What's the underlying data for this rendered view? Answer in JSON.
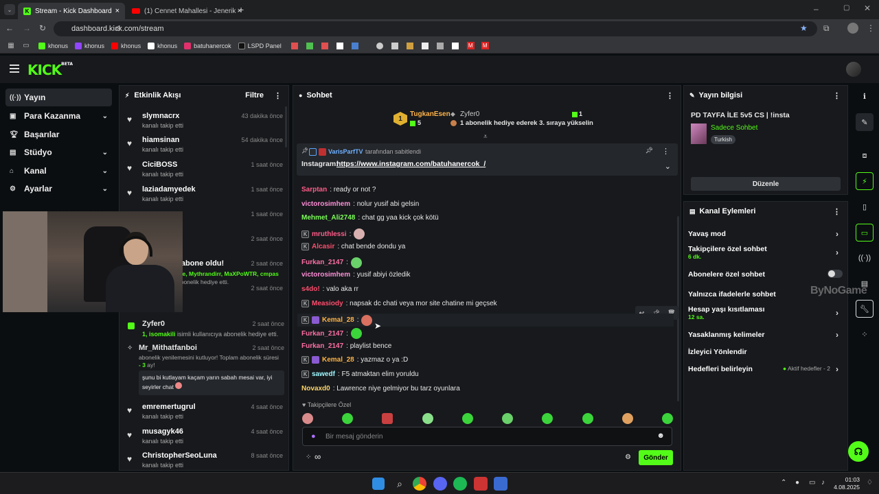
{
  "browser": {
    "tabs": [
      {
        "title": "Stream - Kick Dashboard"
      },
      {
        "title": "(1) Cennet Mahallesi - Jenerik -"
      }
    ],
    "new_tab": "+",
    "url": "dashboard.kick.com/stream",
    "bookmarks": [
      {
        "label": "khonus",
        "color": "#53fc18"
      },
      {
        "label": "khonus",
        "color": "#9146ff"
      },
      {
        "label": "khonus",
        "color": "#ff0000"
      },
      {
        "label": "khonus",
        "color": "#ffffff"
      },
      {
        "label": "batuhanercok",
        "color": "#e1306c"
      },
      {
        "label": "LSPD Panel",
        "color": "#333333"
      }
    ]
  },
  "app": {
    "logo": "KICK",
    "logo_tag": "BETA",
    "accent": "#53fc18"
  },
  "sidebar": {
    "items": [
      {
        "label": "Yayın",
        "icon": "broadcast-icon",
        "chevron": false
      },
      {
        "label": "Para Kazanma",
        "icon": "money-icon",
        "chevron": true
      },
      {
        "label": "Başarılar",
        "icon": "trophy-icon",
        "chevron": false
      },
      {
        "label": "Stüdyo",
        "icon": "studio-icon",
        "chevron": true
      },
      {
        "label": "Kanal",
        "icon": "channel-icon",
        "chevron": true
      },
      {
        "label": "Ayarlar",
        "icon": "gear-icon",
        "chevron": true
      }
    ]
  },
  "activity": {
    "title": "Etkinlik Akışı",
    "filter": "Filtre",
    "events": [
      {
        "name": "slymnacrx",
        "sub": "kanalı takip etti",
        "time": "43 dakika önce"
      },
      {
        "name": "hiamsinan",
        "sub": "kanalı takip etti",
        "time": "54 dakika önce"
      },
      {
        "name": "CiciBOSS",
        "sub": "kanalı takip etti",
        "time": "1 saat önce"
      },
      {
        "name": "laziadamyedek",
        "sub": "kanalı takip etti",
        "time": "1 saat önce"
      },
      {
        "name": "",
        "sub": "",
        "time": "1 saat önce"
      },
      {
        "name": "",
        "sub": "",
        "time": "2 saat önce"
      },
      {
        "name": "ci yeniden abone oldu!",
        "sub": "dular",
        "time": "2 saat önce"
      },
      {
        "name": "",
        "sub": "",
        "time": "2 saat önce"
      }
    ],
    "gift_line1": "efe, Mythrandirr, MaXPoWTR, cmpas",
    "gift_line2": "abonelik hediye etti.",
    "zyfer_name": "Zyfer0",
    "zyfer_time": "2 saat önce",
    "zyfer_sub_user": "1, isomakili",
    "zyfer_sub_rest": " isimli kullanıcıya abonelik hediye etti.",
    "mithat_name": "Mr_Mithatfanboi",
    "mithat_time": "2 saat önce",
    "mithat_sub": "abonelik yenilemesini kutluyor! Toplam abonelik süresi",
    "mithat_months": "- 3",
    "mithat_months_suffix": " ay!",
    "mithat_msg": "şunu bi kutlayam kaçam yarın sabah mesai var, iyi seyirler chat",
    "events2": [
      {
        "name": "emremertugrul",
        "sub": "kanalı takip etti",
        "time": "4 saat önce"
      },
      {
        "name": "musagyk46",
        "sub": "kanalı takip etti",
        "time": "4 saat önce"
      },
      {
        "name": "ChristopherSeoLuna",
        "sub": "kanalı takip etti",
        "time": "8 saat önce"
      }
    ]
  },
  "chat": {
    "title": "Sohbet",
    "top_gifter": {
      "rank": "1",
      "name": "TugkanEsen",
      "count": "5"
    },
    "top2": {
      "name": "Zyfer0",
      "count": "1",
      "text": "1 abonelik hediye ederek 3. sıraya yükselin"
    },
    "pinned": {
      "by_user": "VarisParfTV",
      "by_text": "tarafından sabitlendi",
      "label": "Instagram:",
      "link": "https://www.instagram.com/batuhanercok_/"
    },
    "messages": [
      {
        "user": "Sarptan",
        "color": "#ff5c8a",
        "text": ": ready or not ?",
        "badge": false
      },
      {
        "user": "victorosimhem",
        "color": "#ff8fd8",
        "text": ": nolur yusif abi gelsin",
        "badge": false
      },
      {
        "user": "Mehmet_Ali2748",
        "color": "#7dff5a",
        "text": ": chat gg yaa kick çok kötü",
        "badge": false
      },
      {
        "user": "mruthlessi",
        "color": "#ff5c8a",
        "text": ":",
        "badge": true
      },
      {
        "user": "Alcasir",
        "color": "#ff4d6d",
        "text": ": chat bende dondu ya",
        "badge": true
      },
      {
        "user": "Furkan_2147",
        "color": "#ff6fa5",
        "text": ":",
        "badge": false
      },
      {
        "user": "victorosimhem",
        "color": "#ff8fd8",
        "text": ": yusif abiyi özledik",
        "badge": false
      },
      {
        "user": "s4do!",
        "color": "#ff4d6d",
        "text": ": valo aka rr",
        "badge": false
      },
      {
        "user": "Measiody",
        "color": "#ff4d6d",
        "text": ": napsak dc chati veya mor site chatine mi geçsek",
        "badge": true
      },
      {
        "user": "Kemal_28",
        "color": "#ffb347",
        "text": ":",
        "badge": true
      },
      {
        "user": "Furkan_2147",
        "color": "#ff6fa5",
        "text": ":",
        "badge": false
      },
      {
        "user": "Furkan_2147",
        "color": "#ff6fa5",
        "text": ": playlist bence",
        "badge": false
      },
      {
        "user": "Kemal_28",
        "color": "#ffb347",
        "text": ": yazmaz o ya :D",
        "badge": true
      },
      {
        "user": "sawedf",
        "color": "#9ef7ff",
        "text": ": F5 atmaktan elim yoruldu",
        "badge": true
      },
      {
        "user": "Novaxd0",
        "color": "#ffd66b",
        "text": ": Lawrence niye gelmiyor bu tarz oyunlara",
        "badge": false
      }
    ],
    "followers_only": "Takipçilere Özel",
    "input_placeholder": "Bir mesaj gönderin",
    "send": "Gönder",
    "infinity": "∞"
  },
  "stream_info": {
    "title": "Yayın bilgisi",
    "stream_title": "PD TAYFA İLE 5v5 CS | !insta",
    "category": "Sadece Sohbet",
    "tag": "Turkish",
    "edit": "Düzenle"
  },
  "channel_actions": {
    "title": "Kanal Eylemleri",
    "rows": [
      {
        "label": "Yavaş mod",
        "sub": "",
        "arrow": true
      },
      {
        "label": "Takipçilere özel sohbet",
        "sub": "6 dk.",
        "arrow": true
      },
      {
        "label": "Abonelere özel sohbet",
        "sub": "",
        "arrow": false
      },
      {
        "label": "Yalnızca ifadelerle sohbet",
        "sub": "",
        "arrow": false
      },
      {
        "label": "Hesap yaşı kısıtlaması",
        "sub": "12 sa.",
        "arrow": true
      },
      {
        "label": "Yasaklanmış kelimeler",
        "sub": "",
        "arrow": true
      },
      {
        "label": "İzleyici Yönlendir",
        "sub": "",
        "arrow": false
      },
      {
        "label": "Hedefleri belirleyin",
        "sub": "",
        "arrow": true
      }
    ],
    "goals_status": "Aktif hedefler - 2",
    "watermark": "ByNoGame"
  },
  "taskbar": {
    "time": "01:03",
    "date": "4.08.2025"
  }
}
